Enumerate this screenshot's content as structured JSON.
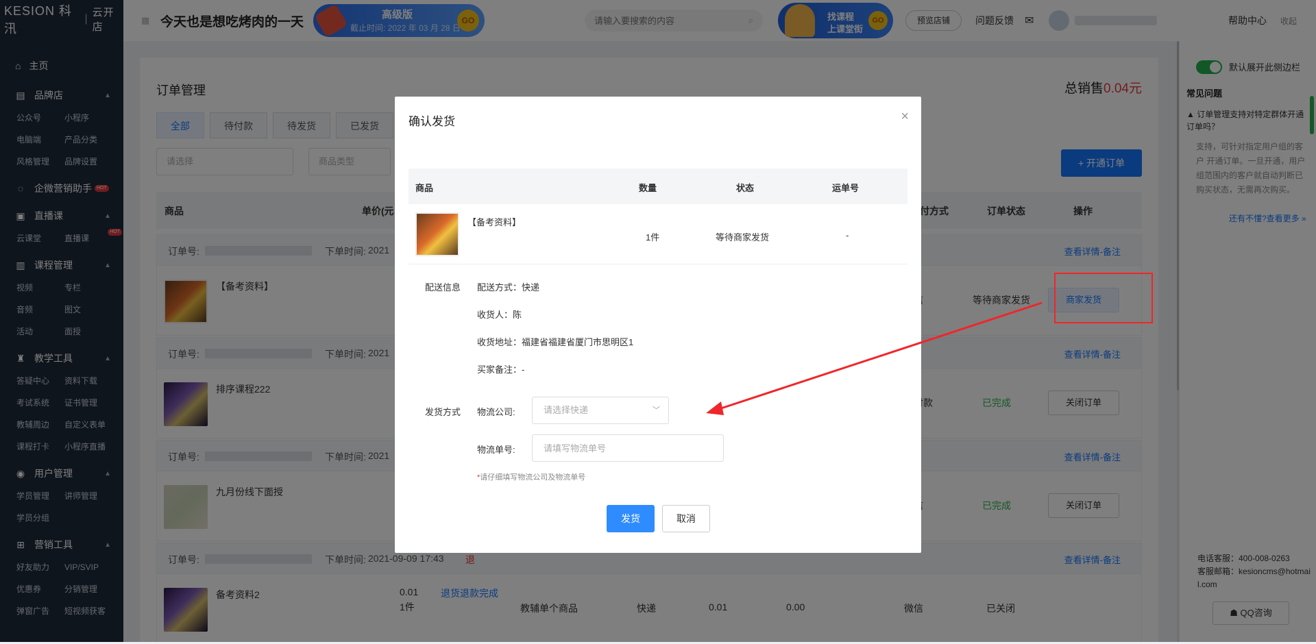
{
  "sidebar": {
    "logo": "KESION 科汛",
    "logo_sub": "云开店",
    "home": "主页",
    "groups": [
      {
        "title": "品牌店",
        "items": [
          "公众号",
          "小程序",
          "电脑端",
          "产品分类",
          "风格管理",
          "品牌设置"
        ]
      },
      {
        "title": "企微营销助手",
        "items": [],
        "hot": "HOT"
      },
      {
        "title": "直播课",
        "items": [
          "云课堂",
          "直播课"
        ],
        "item_hot": "HOT"
      },
      {
        "title": "课程管理",
        "items": [
          "视频",
          "专栏",
          "音频",
          "图文",
          "活动",
          "面授"
        ]
      },
      {
        "title": "教学工具",
        "items": [
          "答疑中心",
          "资料下载",
          "考试系统",
          "证书管理",
          "教辅周边",
          "自定义表单",
          "课程打卡",
          "小程序直播"
        ]
      },
      {
        "title": "用户管理",
        "items": [
          "学员管理",
          "讲师管理",
          "学员分组"
        ]
      },
      {
        "title": "营销工具",
        "items": [
          "好友助力",
          "VIP/SVIP",
          "优惠券",
          "分销管理",
          "弹窗广告",
          "短视频获客"
        ]
      }
    ]
  },
  "topbar": {
    "shop_name": "今天也是想吃烤肉的一天",
    "version_title": "高级版",
    "version_expire_prefix": "截止时间:",
    "version_expire": "2022 年 03 月 28 日",
    "go": "GO",
    "search_placeholder": "请输入要搜索的内容",
    "course_line1": "找课程",
    "course_line2": "上课堂街",
    "preview_store": "预览店铺",
    "feedback": "问题反馈",
    "help": "帮助中心",
    "collapse": "收起"
  },
  "main": {
    "title": "订单管理",
    "total_label": "总销售",
    "total_amount": "0.04元",
    "tabs": [
      "全部",
      "待付款",
      "待发货",
      "已发货"
    ],
    "filter_placeholder": "请选择",
    "filter_type": "商品类型",
    "open_order": "+ 开通订单",
    "headers": {
      "product": "商品",
      "price": "单价(元",
      "pay_method": "支付方式",
      "status": "订单状态",
      "action": "操作"
    },
    "order_label": "订单号:",
    "time_label": "下单时间:",
    "view_label": "查看详情-备注",
    "orders": [
      {
        "time": "2021",
        "name": "【备考资料】",
        "pay": "微信",
        "status": "等待商家发货",
        "action": "商家发货"
      },
      {
        "time": "2021",
        "name": "排序课程222",
        "pay": "线下付款",
        "status": "已完成",
        "action": "关闭订单"
      },
      {
        "time": "2021",
        "name": "九月份线下面授",
        "pay": "微信",
        "status": "已完成",
        "action": "关闭订单"
      },
      {
        "time": "2021-09-09 17:43",
        "ret": "退",
        "name": "备考资料2",
        "price": "0.01",
        "qty": "1件",
        "refund": "退货退款完成",
        "cat": "教辅单个商品",
        "ship": "快递",
        "amt1": "0.01",
        "amt2": "0.00",
        "pay": "微信",
        "status": "已关闭"
      }
    ]
  },
  "right_panel": {
    "toggle_label": "默认展开此侧边栏",
    "faq_title": "常见问题",
    "faq_q": "▲ 订单管理支持对特定群体开通订单吗？",
    "faq_a": "支持，可针对指定用户组的客户 开通订单。一旦开通，用户组范围内的客户就自动判断已购买状态，无需再次购买。",
    "faq_more": "还有不懂?查看更多 »",
    "phone": "电话客服：400-008-0263",
    "email": "客服邮箱：kesioncms@hotmail.com",
    "qq": "QQ咨询"
  },
  "modal": {
    "title": "确认发货",
    "close": "×",
    "headers": {
      "product": "商品",
      "qty": "数量",
      "status": "状态",
      "waybill": "运单号"
    },
    "item": {
      "name": "【备考资料】",
      "qty": "1件",
      "status": "等待商家发货",
      "waybill": "-"
    },
    "delivery_info_label": "配送信息",
    "delivery_method": "配送方式：快递",
    "receiver": "收货人：陈",
    "address": "收货地址：福建省福建省厦门市思明区1",
    "buyer_note": "买家备注：-",
    "ship_method_label": "发货方式",
    "logistics_company_label": "物流公司:",
    "logistics_company_placeholder": "请选择快递",
    "tracking_label": "物流单号:",
    "tracking_placeholder": "请填写物流单号",
    "hint_req": "*",
    "hint": "请仔细填写物流公司及物流单号",
    "ok": "发货",
    "cancel": "取消"
  },
  "colors": {
    "primary": "#1677ff",
    "danger": "#e4393c",
    "success": "#2ab04a",
    "sidebar_bg": "#1f2a3a",
    "annotation": "#f0262a"
  }
}
